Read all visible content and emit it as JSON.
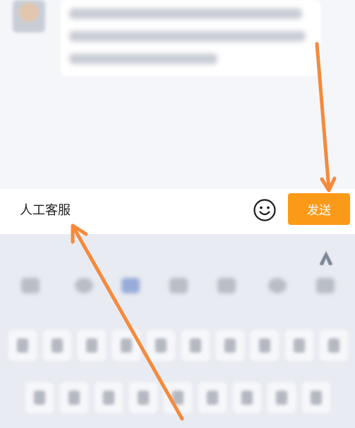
{
  "input": {
    "value": "人工客服"
  },
  "send_button": {
    "label": "发送",
    "color": "#fb9a18"
  },
  "icons": {
    "emoji": "smiley-face-icon",
    "keyboard_logo": "keyboard-brand-logo-icon"
  },
  "colors": {
    "accent": "#fb9a18",
    "annotation_arrow": "#f58a3c",
    "keyboard_bg": "#e9ebf2",
    "chat_bg": "#f5f6fa"
  }
}
